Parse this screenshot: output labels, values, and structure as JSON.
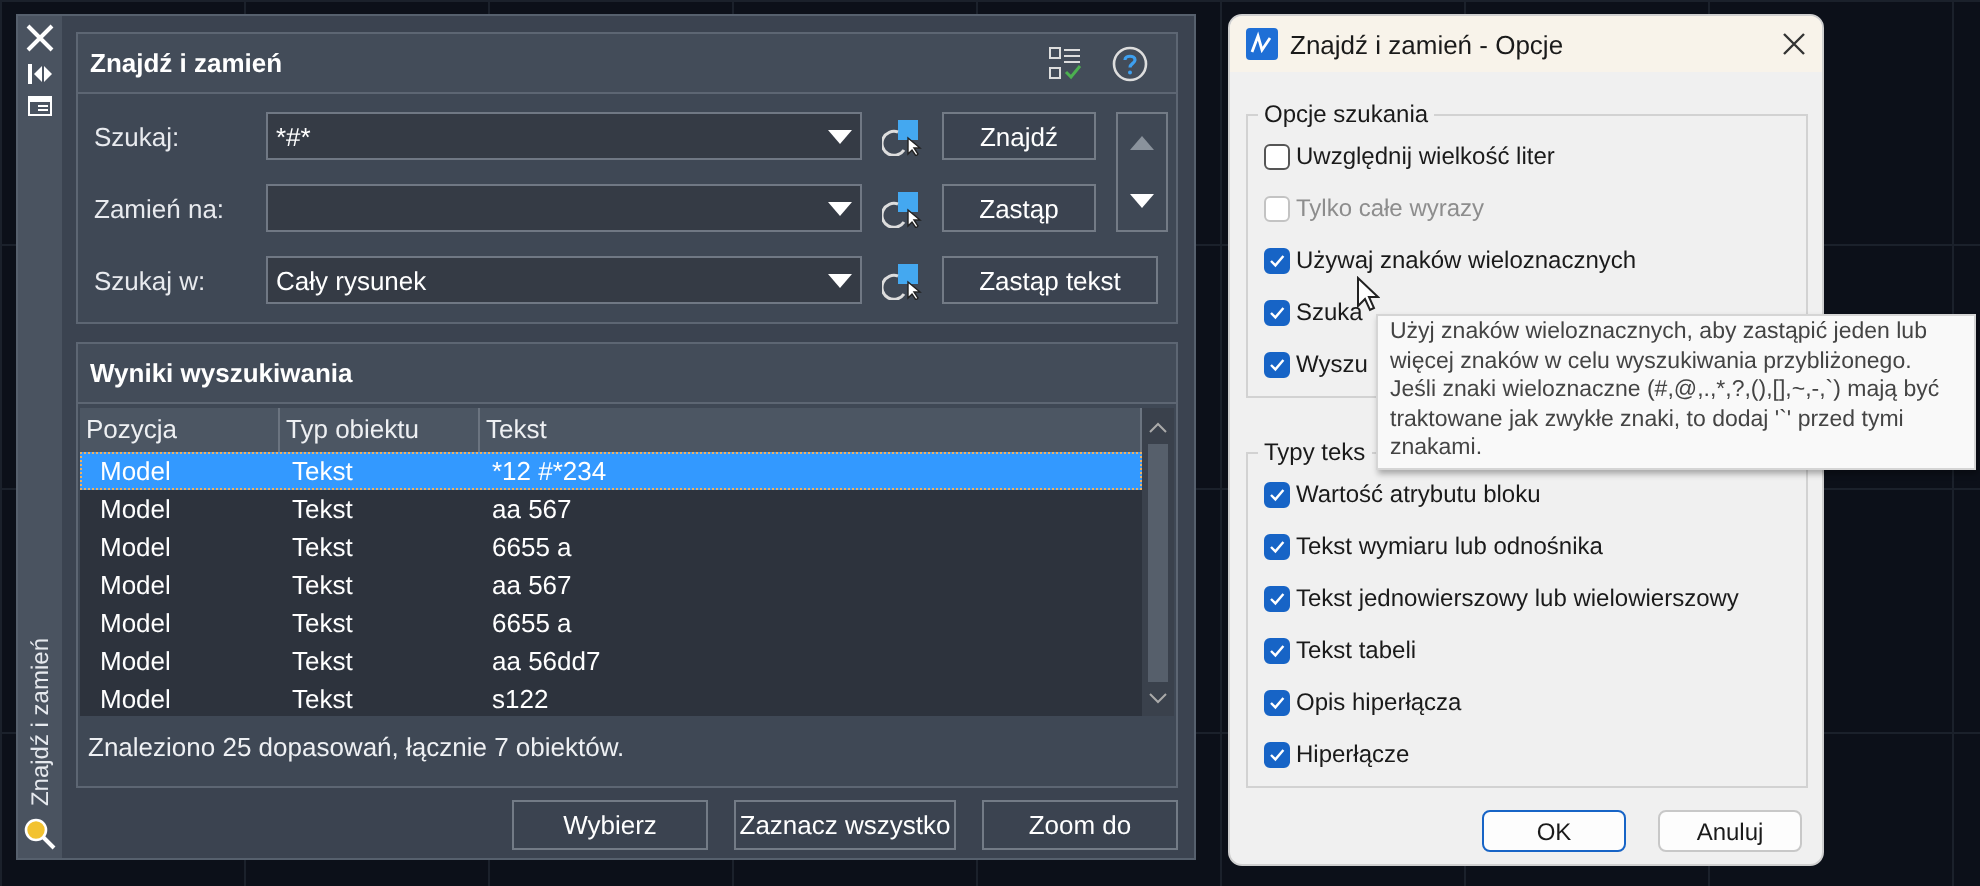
{
  "side_strip": {
    "title": "Znajdź i zamień"
  },
  "find_section": {
    "title": "Znajdź i zamień",
    "fields": [
      {
        "label": "Szukaj:",
        "value": "*#*"
      },
      {
        "label": "Zamień na:"
      },
      {
        "label": "Szukaj w:",
        "value": "Cały rysunek"
      }
    ],
    "buttons": [
      "Znajdź",
      "Zastąp",
      "Zastąp tekst"
    ]
  },
  "results": {
    "title": "Wyniki wyszukiwania",
    "columns": [
      "Pozycja",
      "Typ obiektu",
      "Tekst"
    ],
    "rows": [
      {
        "cells": [
          "Model",
          "Tekst",
          "*12 #*234"
        ],
        "selected": true
      },
      {
        "cells": [
          "Model",
          "Tekst",
          "aa 567"
        ],
        "selected": false
      },
      {
        "cells": [
          "Model",
          "Tekst",
          "6655 a"
        ],
        "selected": false
      },
      {
        "cells": [
          "Model",
          "Tekst",
          "aa 567"
        ],
        "selected": false
      },
      {
        "cells": [
          "Model",
          "Tekst",
          "6655 a"
        ],
        "selected": false
      },
      {
        "cells": [
          "Model",
          "Tekst",
          "aa 56dd7"
        ],
        "selected": false
      },
      {
        "cells": [
          "Model",
          "Tekst",
          "s122"
        ],
        "selected": false
      }
    ],
    "status": "Znaleziono 25 dopasowań, łącznie 7 obiektów."
  },
  "buttons": [
    "Wybierz",
    "Zaznacz wszystko",
    "Zoom do"
  ],
  "options_dialog": {
    "title": "Znajdź i zamień - Opcje",
    "groups": [
      {
        "title": "Opcje szukania",
        "options": [
          {
            "label": "Uwzględnij wielkość liter",
            "checked": false,
            "disabled": false
          },
          {
            "label": "Tylko całe wyrazy",
            "checked": false,
            "disabled": true
          },
          {
            "label": "Używaj znaków wieloznacznych",
            "checked": true,
            "disabled": false
          },
          {
            "label": "Szuka",
            "checked": true,
            "disabled": false
          },
          {
            "label": "Wyszu",
            "checked": true,
            "disabled": false
          }
        ]
      },
      {
        "title": "Typy teks",
        "options": [
          {
            "label": "Wartość atrybutu bloku",
            "checked": true,
            "disabled": false
          },
          {
            "label": "Tekst wymiaru lub odnośnika",
            "checked": true,
            "disabled": false
          },
          {
            "label": "Tekst jednowierszowy lub wielowierszowy",
            "checked": true,
            "disabled": false
          },
          {
            "label": "Tekst tabeli",
            "checked": true,
            "disabled": false
          },
          {
            "label": "Opis hiperłącza",
            "checked": true,
            "disabled": false
          },
          {
            "label": "Hiperłącze",
            "checked": true,
            "disabled": false
          }
        ]
      }
    ],
    "tooltip": "Użyj znaków wieloznacznych, aby zastąpić jeden lub więcej znaków w celu wyszukiwania przybliżonego. Jeśli znaki wieloznaczne (#,@,.,*,?,(),[],~,-,`) mają być traktowane jak zwykłe znaki, to dodaj '`' przed tymi znakami.",
    "buttons": [
      "OK",
      "Anuluj"
    ]
  }
}
